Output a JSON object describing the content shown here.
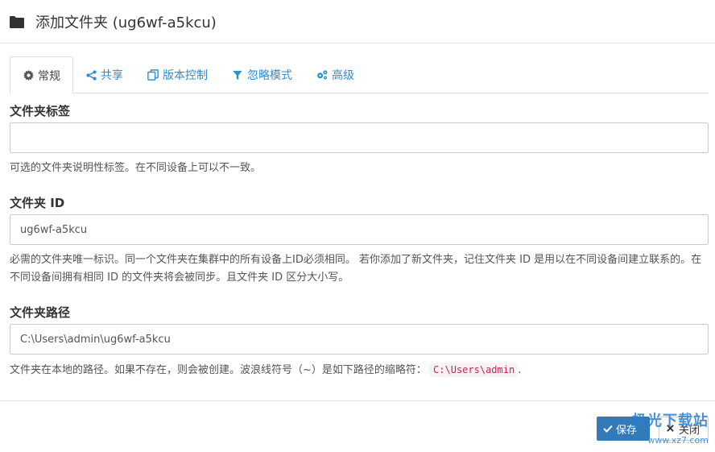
{
  "header": {
    "title": "添加文件夹 (ug6wf-a5kcu)",
    "icon": "folder-icon"
  },
  "tabs": [
    {
      "label": "常规",
      "icon": "gear-icon",
      "active": true
    },
    {
      "label": "共享",
      "icon": "share-icon",
      "active": false
    },
    {
      "label": "版本控制",
      "icon": "copy-icon",
      "active": false
    },
    {
      "label": "忽略模式",
      "icon": "filter-icon",
      "active": false
    },
    {
      "label": "高级",
      "icon": "gears-icon",
      "active": false
    }
  ],
  "fields": {
    "label": {
      "title": "文件夹标签",
      "value": "",
      "help": "可选的文件夹说明性标签。在不同设备上可以不一致。"
    },
    "id": {
      "title": "文件夹 ID",
      "value": "ug6wf-a5kcu",
      "help": "必需的文件夹唯一标识。同一个文件夹在集群中的所有设备上ID必须相同。 若你添加了新文件夹，记住文件夹 ID 是用以在不同设备间建立联系的。在不同设备间拥有相同 ID 的文件夹将会被同步。且文件夹 ID 区分大小写。"
    },
    "path": {
      "title": "文件夹路径",
      "value": "C:\\Users\\admin\\ug6wf-a5kcu",
      "help_prefix": "文件夹在本地的路径。如果不存在，则会被创建。波浪线符号（~）是如下路径的缩略符：",
      "help_code": "C:\\Users\\admin",
      "help_suffix": "."
    }
  },
  "footer": {
    "save_label": "保存",
    "close_label": "关闭"
  },
  "watermark": {
    "title": "极光下载站",
    "url": "www.xz7.com"
  },
  "colors": {
    "accent": "#2e8ece",
    "primary_button": "#337ab7",
    "code_text": "#c7254e",
    "code_bg": "#f9f2f4"
  }
}
